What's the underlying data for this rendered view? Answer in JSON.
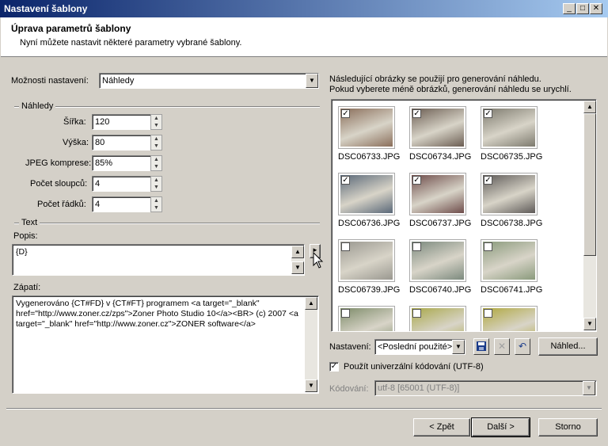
{
  "window": {
    "title": "Nastavení šablony"
  },
  "header": {
    "title": "Úprava parametrů šablony",
    "subtitle": "Nyní můžete nastavit některé parametry vybrané šablony."
  },
  "settings": {
    "label": "Možnosti nastavení:",
    "value": "Náhledy"
  },
  "group_nahledy": {
    "label": "Náhledy",
    "fields": [
      {
        "label": "Šířka:",
        "value": "120"
      },
      {
        "label": "Výška:",
        "value": "80"
      },
      {
        "label": "JPEG komprese:",
        "value": "85%"
      },
      {
        "label": "Počet sloupců:",
        "value": "4"
      },
      {
        "label": "Počet řádků:",
        "value": "4"
      }
    ]
  },
  "group_text": {
    "label": "Text",
    "popis_label": "Popis:",
    "popis_value": "{D}",
    "zapati_label": "Zápatí:",
    "zapati_value": "Vygenerováno {CT#FD} v {CT#FT} programem <a target=\"_blank\" href=\"http://www.zoner.cz/zps\">Zoner Photo Studio 10</a><BR> (c) 2007 <a target=\"_blank\" href=\"http://www.zoner.cz\">ZONER software</a>"
  },
  "preview": {
    "info_line1": "Následující obrázky se použijí pro generování náhledu.",
    "info_line2": "Pokud vyberete méně obrázků, generování náhledu se urychlí.",
    "images": [
      {
        "name": "DSC06733.JPG",
        "checked": true,
        "color": "#8a6e5a"
      },
      {
        "name": "DSC06734.JPG",
        "checked": true,
        "color": "#6b5d52"
      },
      {
        "name": "DSC06735.JPG",
        "checked": true,
        "color": "#7d7a6e"
      },
      {
        "name": "DSC06736.JPG",
        "checked": true,
        "color": "#5a6878"
      },
      {
        "name": "DSC06737.JPG",
        "checked": true,
        "color": "#6e4c4a"
      },
      {
        "name": "DSC06738.JPG",
        "checked": true,
        "color": "#5e5a58"
      },
      {
        "name": "DSC06739.JPG",
        "checked": false,
        "color": "#9a9890"
      },
      {
        "name": "DSC06740.JPG",
        "checked": false,
        "color": "#7c8a7e"
      },
      {
        "name": "DSC06741.JPG",
        "checked": false,
        "color": "#8a9a7c"
      },
      {
        "name": "",
        "checked": false,
        "color": "#7e8c6a"
      },
      {
        "name": "",
        "checked": false,
        "color": "#a9a84a"
      },
      {
        "name": "",
        "checked": false,
        "color": "#b0a840"
      }
    ]
  },
  "nastaveni": {
    "label": "Nastavení:",
    "value": "<Poslední použité>",
    "preview_button": "Náhled..."
  },
  "utf8": {
    "label": "Použít univerzální kódování (UTF-8)",
    "checked": true
  },
  "kodovani": {
    "label": "Kódování:",
    "value": "utf-8   [65001 (UTF-8)]"
  },
  "footer": {
    "back": "< Zpět",
    "next": "Další >",
    "cancel": "Storno"
  }
}
